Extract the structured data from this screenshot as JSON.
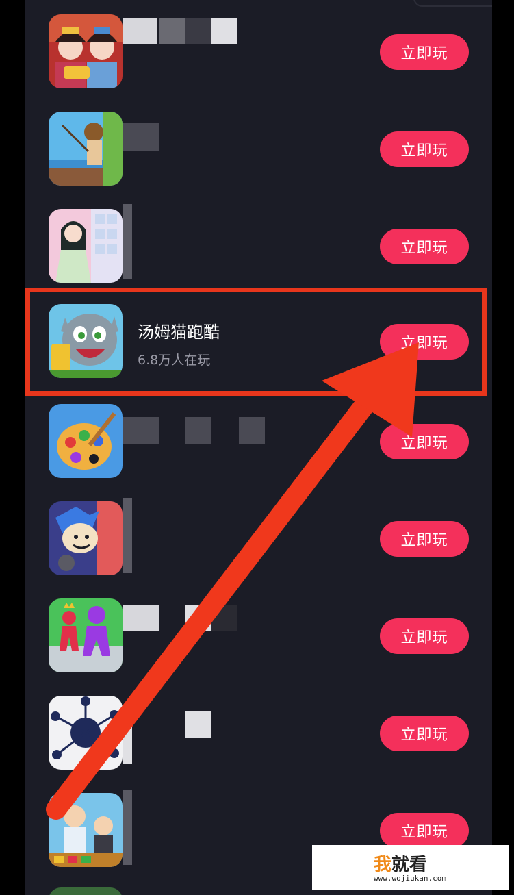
{
  "colors": {
    "background": "#1b1c26",
    "button": "#f4305b",
    "annotation": "#e8361c"
  },
  "game_list": [
    {
      "title": "",
      "players": "",
      "icon": "palace-girls-icon",
      "button": "立即玩"
    },
    {
      "title": "",
      "players": "",
      "icon": "fishing-man-icon",
      "button": "立即玩"
    },
    {
      "title": "",
      "players": "",
      "icon": "dress-up-girl-icon",
      "button": "立即玩"
    },
    {
      "title": "汤姆猫跑酷",
      "players": "6.8万人在玩",
      "icon": "talking-tom-icon",
      "button": "立即玩"
    },
    {
      "title": "",
      "players": "",
      "icon": "paint-palette-icon",
      "button": "立即玩"
    },
    {
      "title": "",
      "players": "",
      "icon": "rhythm-boy-icon",
      "button": "立即玩"
    },
    {
      "title": "",
      "players": "",
      "icon": "stickman-run-icon",
      "button": "立即玩"
    },
    {
      "title": "",
      "players": "",
      "icon": "aa-dots-icon",
      "button": "立即玩"
    },
    {
      "title": "",
      "players": "",
      "icon": "chef-grandpa-icon",
      "button": "立即玩"
    }
  ],
  "watermark": {
    "brand_accent": "我",
    "brand_rest": "就看",
    "url": "www.wojiukan.com"
  }
}
